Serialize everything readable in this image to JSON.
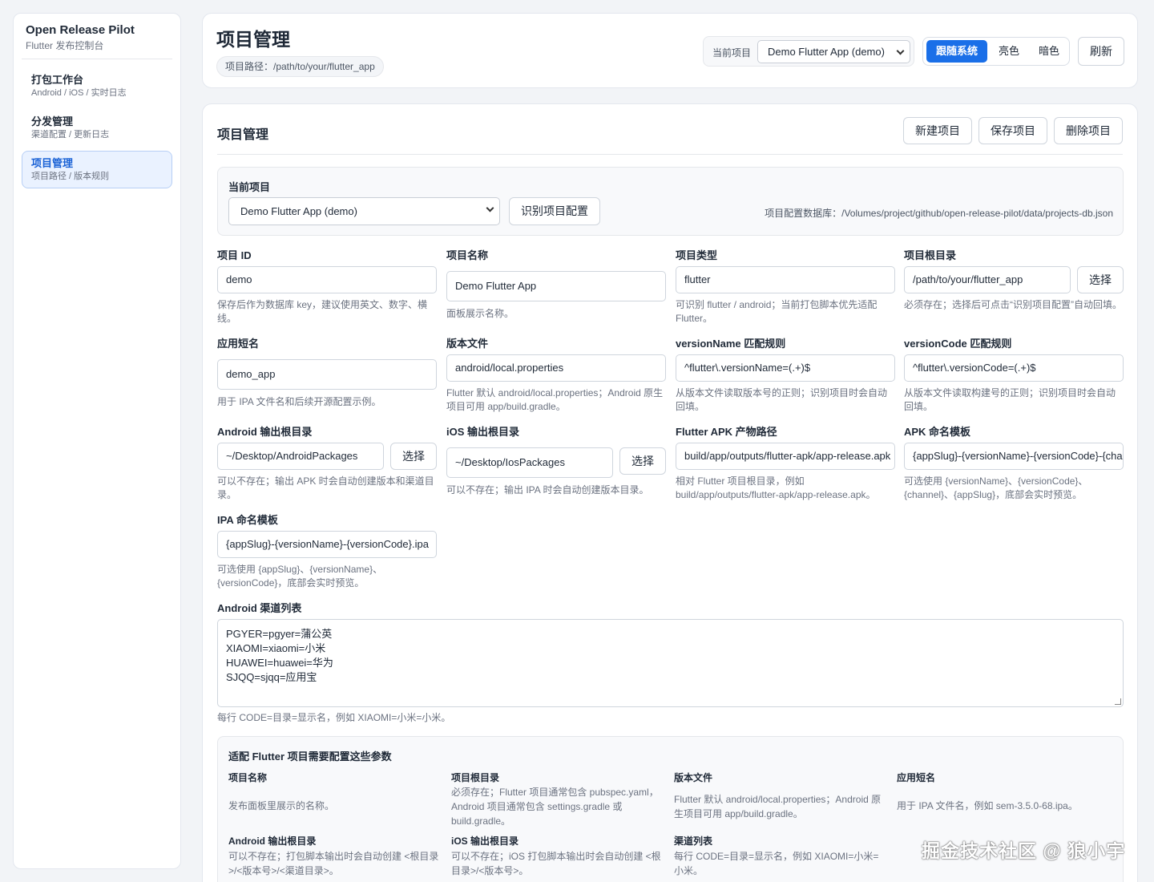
{
  "sidebar": {
    "brand_title": "Open Release Pilot",
    "brand_sub": "Flutter 发布控制台",
    "items": [
      {
        "title": "打包工作台",
        "sub": "Android / iOS / 实时日志"
      },
      {
        "title": "分发管理",
        "sub": "渠道配置 / 更新日志"
      },
      {
        "title": "项目管理",
        "sub": "项目路径 / 版本规则"
      }
    ]
  },
  "header": {
    "title": "项目管理",
    "path": "项目路径：/path/to/your/flutter_app",
    "project_label": "当前项目",
    "project_value": "Demo Flutter App (demo)",
    "theme": [
      "跟随系统",
      "亮色",
      "暗色"
    ],
    "refresh": "刷新"
  },
  "main": {
    "title": "项目管理",
    "buttons": [
      "新建项目",
      "保存项目",
      "删除项目"
    ],
    "current_label": "当前项目",
    "current_value": "Demo Flutter App (demo)",
    "detect_button": "识别项目配置",
    "db_path": "项目配置数据库：/Volumes/project/github/open-release-pilot/data/projects-db.json",
    "choose": "选择",
    "fields": {
      "project_id": {
        "label": "项目 ID",
        "value": "demo",
        "hint": "保存后作为数据库 key，建议使用英文、数字、横线。"
      },
      "project_name": {
        "label": "项目名称",
        "value": "Demo Flutter App",
        "hint": "面板展示名称。"
      },
      "project_type": {
        "label": "项目类型",
        "value": "flutter",
        "hint": "可识别 flutter / android；当前打包脚本优先适配 Flutter。"
      },
      "project_root": {
        "label": "项目根目录",
        "value": "/path/to/your/flutter_app",
        "hint": "必须存在；选择后可点击“识别项目配置”自动回填。"
      },
      "app_slug": {
        "label": "应用短名",
        "value": "demo_app",
        "hint": "用于 IPA 文件名和后续开源配置示例。"
      },
      "version_file": {
        "label": "版本文件",
        "value": "android/local.properties",
        "hint": "Flutter 默认 android/local.properties；Android 原生项目可用 app/build.gradle。"
      },
      "version_name_rule": {
        "label": "versionName 匹配规则",
        "value": "^flutter\\.versionName=(.+)$",
        "hint": "从版本文件读取版本号的正则；识别项目时会自动回填。"
      },
      "version_code_rule": {
        "label": "versionCode 匹配规则",
        "value": "^flutter\\.versionCode=(.+)$",
        "hint": "从版本文件读取构建号的正则；识别项目时会自动回填。"
      },
      "android_out": {
        "label": "Android 输出根目录",
        "value": "~/Desktop/AndroidPackages",
        "hint": "可以不存在；输出 APK 时会自动创建版本和渠道目录。"
      },
      "ios_out": {
        "label": "iOS 输出根目录",
        "value": "~/Desktop/IosPackages",
        "hint": "可以不存在；输出 IPA 时会自动创建版本目录。"
      },
      "apk_path": {
        "label": "Flutter APK 产物路径",
        "value": "build/app/outputs/flutter-apk/app-release.apk",
        "hint": "相对 Flutter 项目根目录，例如 build/app/outputs/flutter-apk/app-release.apk。"
      },
      "apk_template": {
        "label": "APK 命名模板",
        "value": "{appSlug}-{versionName}-{versionCode}-{channel}.apk",
        "hint": "可选使用 {versionName}、{versionCode}、{channel}、{appSlug}，底部会实时预览。"
      },
      "ipa_template": {
        "label": "IPA 命名模板",
        "value": "{appSlug}-{versionName}-{versionCode}.ipa",
        "hint": "可选使用 {appSlug}、{versionName}、{versionCode}，底部会实时预览。"
      }
    },
    "channels": {
      "label": "Android 渠道列表",
      "lines": [
        "PGYER=pgyer=蒲公英",
        "XIAOMI=xiaomi=小米",
        "HUAWEI=huawei=华为",
        "SJQQ=sjqq=应用宝"
      ],
      "hint": "每行 CODE=目录=显示名，例如 XIAOMI=小米=小米。"
    },
    "info": {
      "title": "适配 Flutter 项目需要配置这些参数",
      "items": [
        {
          "k": "项目名称",
          "v": "发布面板里展示的名称。"
        },
        {
          "k": "项目根目录",
          "v": "必须存在；Flutter 项目通常包含 pubspec.yaml，Android 项目通常包含 settings.gradle 或 build.gradle。"
        },
        {
          "k": "版本文件",
          "v": "Flutter 默认 android/local.properties；Android 原生项目可用 app/build.gradle。"
        },
        {
          "k": "应用短名",
          "v": "用于 IPA 文件名，例如 sem-3.5.0-68.ipa。"
        },
        {
          "k": "Android 输出根目录",
          "v": "可以不存在；打包脚本输出时会自动创建 <根目录>/<版本号>/<渠道目录>。"
        },
        {
          "k": "iOS 输出根目录",
          "v": "可以不存在；iOS 打包脚本输出时会自动创建 <根目录>/<版本号>。"
        },
        {
          "k": "渠道列表",
          "v": "每行 CODE=目录=显示名，例如 XIAOMI=小米=小米。"
        }
      ]
    }
  },
  "watermark": "掘金技术社区 @ 狼小宇"
}
